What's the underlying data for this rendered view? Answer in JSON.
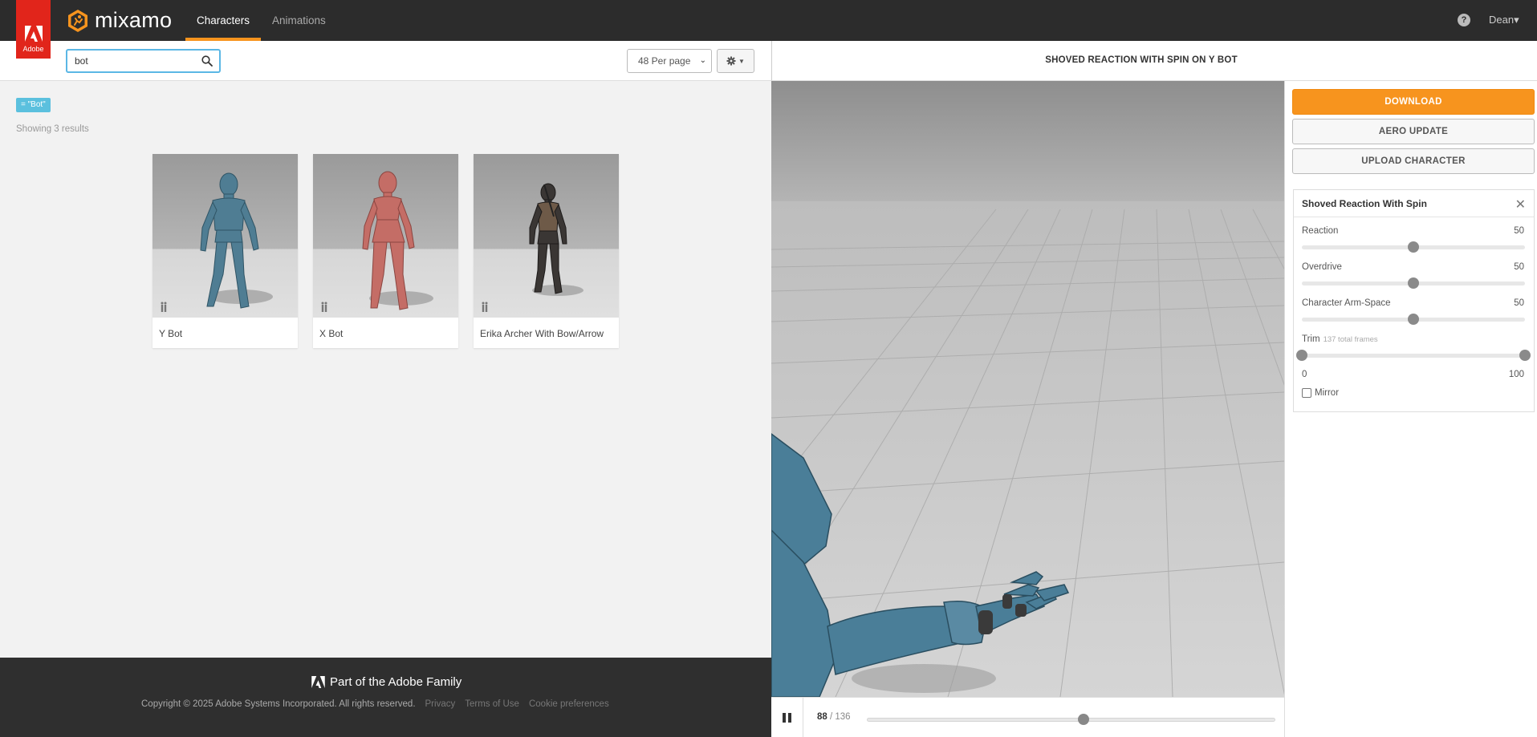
{
  "app": {
    "brand_name": "mixamo",
    "adobe_label": "Adobe",
    "nav": [
      {
        "label": "Characters",
        "active": true
      },
      {
        "label": "Animations",
        "active": false
      }
    ],
    "help_symbol": "?",
    "user_name": "Dean",
    "user_caret": "▾",
    "accent_color": "#f7941e",
    "adobe_red": "#e1251b"
  },
  "toolbar": {
    "search_value": "bot",
    "search_icon": "search-icon",
    "per_page": "48 Per page",
    "settings_icon": "gear-icon"
  },
  "results": {
    "filter_tag": "= \"Bot\"",
    "count_text": "Showing 3 results",
    "characters": [
      {
        "name": "Y Bot",
        "color": "#4f7d93"
      },
      {
        "name": "X Bot",
        "color": "#c46d66"
      },
      {
        "name": "Erika Archer With Bow/Arrow",
        "color": "#3a3634"
      }
    ]
  },
  "footer": {
    "family_text": "Part of the Adobe Family",
    "copyright": "Copyright © 2025 Adobe Systems Incorporated. All rights reserved.",
    "links": [
      "Privacy",
      "Terms of Use",
      "Cookie preferences"
    ]
  },
  "viewer": {
    "title": "SHOVED REACTION WITH SPIN ON Y BOT",
    "current_frame": "88",
    "frame_separator": " / ",
    "total_frames": "136",
    "timeline_fraction": 0.53
  },
  "side_panel": {
    "download_label": "DOWNLOAD",
    "aero_label": "AERO UPDATE",
    "upload_label": "UPLOAD CHARACTER",
    "animation_name": "Shoved Reaction With Spin",
    "close_symbol": "✕",
    "params": [
      {
        "label": "Reaction",
        "value": "50",
        "fraction": 0.5
      },
      {
        "label": "Overdrive",
        "value": "50",
        "fraction": 0.5
      },
      {
        "label": "Character Arm-Space",
        "value": "50",
        "fraction": 0.5
      }
    ],
    "trim": {
      "label": "Trim",
      "sub": "137 total frames",
      "start": "0",
      "end": "100",
      "start_fraction": 0,
      "end_fraction": 1
    },
    "mirror_label": "Mirror",
    "mirror_checked": false
  }
}
